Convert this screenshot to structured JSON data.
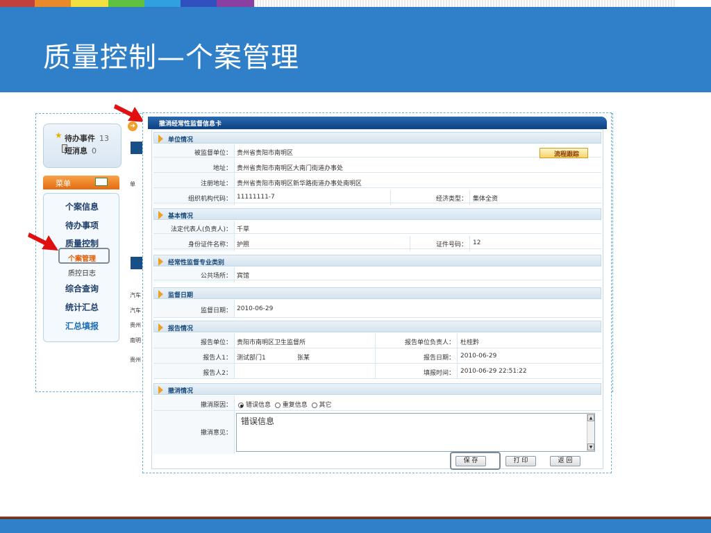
{
  "slide": {
    "title": "质量控制—个案管理"
  },
  "stripe_colors": [
    "#c04040",
    "#e88a2a",
    "#f0e040",
    "#60c040",
    "#30a0e0",
    "#3050c0",
    "#8a40a0",
    "#e0e0e0"
  ],
  "colors": {
    "header_bg": "#2f80c8",
    "arrow": "#e01010"
  },
  "left_panel": {
    "todo_label": "待办事件",
    "todo_count": "13",
    "msg_label": "短消息",
    "msg_count": "0",
    "menu_label": "菜单",
    "menu_items": [
      "个案信息",
      "待办事项",
      "质量控制",
      "个案管理",
      "质控日志",
      "综合查询",
      "统计汇总",
      "汇总填报"
    ],
    "strip_texts": [
      "单",
      "汽车",
      "汽车",
      "贵州",
      "南明",
      "贵州"
    ]
  },
  "card": {
    "title": "撤消经常性监督信息卡",
    "track_button": "流程跟踪",
    "section1": {
      "title": "单位情况",
      "rows": [
        {
          "label": "被监督单位：",
          "value": "贵州省贵阳市南明区"
        },
        {
          "label": "地址：",
          "value": "贵州省贵阳市南明区大南门街道办事处"
        },
        {
          "label": "注册地址：",
          "value": "贵州省贵阳市南明区新华路街道办事处南明区"
        }
      ],
      "org_code_label": "组织机构代码：",
      "org_code": "11111111-7",
      "econ_label": "经济类型：",
      "econ_value": "集体全资"
    },
    "section2": {
      "title": "基本情况",
      "legal_label": "法定代表人(负责人)：",
      "legal_value": "千草",
      "id_label": "身份证件名称：",
      "id_value": "护照",
      "idno_label": "证件号码：",
      "idno_value": "12"
    },
    "section3": {
      "title": "经常性监督专业类别",
      "label": "公共场所：",
      "value": "宾馆"
    },
    "section4": {
      "title": "监督日期",
      "label": "监督日期：",
      "value": "2010-06-29"
    },
    "section5": {
      "title": "报告情况",
      "unit_label": "报告单位：",
      "unit_value": "贵阳市南明区卫生监督所",
      "head_label": "报告单位负责人：",
      "head_value": "杜桂黔",
      "p1_label": "报告人1：",
      "p1_value": "测试部门1",
      "p1_name": "张某",
      "date_label": "报告日期：",
      "date_value": "2010-06-29",
      "p2_label": "报告人2：",
      "time_label": "填报时间：",
      "time_value": "2010-06-29 22:51:22"
    },
    "section6": {
      "title": "撤消情况",
      "reason_label": "撤消原因：",
      "reason_options": [
        "错误信息",
        "重复信息",
        "其它"
      ],
      "reason_selected": "错误信息",
      "opinion_label": "撤消意见：",
      "opinion_value": "错误信息"
    },
    "buttons": {
      "save": "保 存",
      "print": "打 印",
      "back": "返 回"
    }
  }
}
